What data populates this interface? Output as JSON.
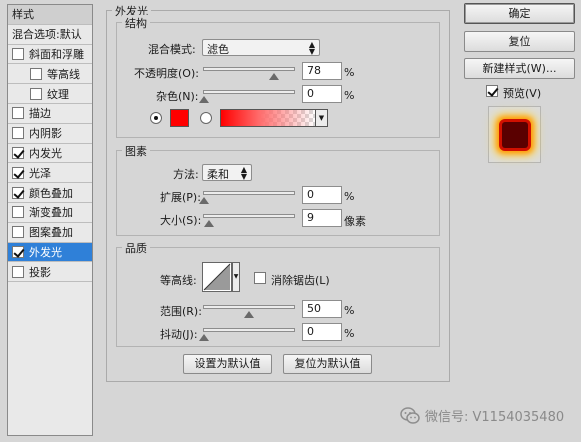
{
  "sidebar": {
    "header": "样式",
    "items": [
      {
        "label": "混合选项:默认",
        "checkbox": false,
        "checked": false,
        "indent": false,
        "active": false
      },
      {
        "label": "斜面和浮雕",
        "checkbox": true,
        "checked": false,
        "indent": false,
        "active": false
      },
      {
        "label": "等高线",
        "checkbox": true,
        "checked": false,
        "indent": true,
        "active": false
      },
      {
        "label": "纹理",
        "checkbox": true,
        "checked": false,
        "indent": true,
        "active": false
      },
      {
        "label": "描边",
        "checkbox": true,
        "checked": false,
        "indent": false,
        "active": false
      },
      {
        "label": "内阴影",
        "checkbox": true,
        "checked": false,
        "indent": false,
        "active": false
      },
      {
        "label": "内发光",
        "checkbox": true,
        "checked": true,
        "indent": false,
        "active": false
      },
      {
        "label": "光泽",
        "checkbox": true,
        "checked": true,
        "indent": false,
        "active": false
      },
      {
        "label": "颜色叠加",
        "checkbox": true,
        "checked": true,
        "indent": false,
        "active": false
      },
      {
        "label": "渐变叠加",
        "checkbox": true,
        "checked": false,
        "indent": false,
        "active": false
      },
      {
        "label": "图案叠加",
        "checkbox": true,
        "checked": false,
        "indent": false,
        "active": false
      },
      {
        "label": "外发光",
        "checkbox": true,
        "checked": true,
        "indent": false,
        "active": true
      },
      {
        "label": "投影",
        "checkbox": true,
        "checked": false,
        "indent": false,
        "active": false
      }
    ]
  },
  "panel": {
    "title": "外发光",
    "structure": {
      "title": "结构",
      "blend_label": "混合模式:",
      "blend_value": "滤色",
      "opacity_label": "不透明度(O):",
      "opacity_value": "78",
      "opacity_pct": 78,
      "noise_label": "杂色(N):",
      "noise_value": "0",
      "noise_pct": 0,
      "percent": "%",
      "glow_color": "#ff0000"
    },
    "elements": {
      "title": "图素",
      "method_label": "方法:",
      "method_value": "柔和",
      "spread_label": "扩展(P):",
      "spread_value": "0",
      "spread_pct": 0,
      "size_label": "大小(S):",
      "size_value": "9",
      "size_pct": 6,
      "percent": "%",
      "px_unit": "像素"
    },
    "quality": {
      "title": "品质",
      "contour_label": "等高线:",
      "antialias_label": "消除锯齿(L)",
      "range_label": "范围(R):",
      "range_value": "50",
      "range_pct": 50,
      "jitter_label": "抖动(J):",
      "jitter_value": "0",
      "jitter_pct": 0,
      "percent": "%"
    },
    "set_default": "设置为默认值",
    "reset_default": "复位为默认值"
  },
  "right": {
    "ok": "确定",
    "reset": "复位",
    "new_style": "新建样式(W)...",
    "preview_label": "预览(V)",
    "preview_checked": true
  },
  "watermark": "微信号: V1154035480"
}
